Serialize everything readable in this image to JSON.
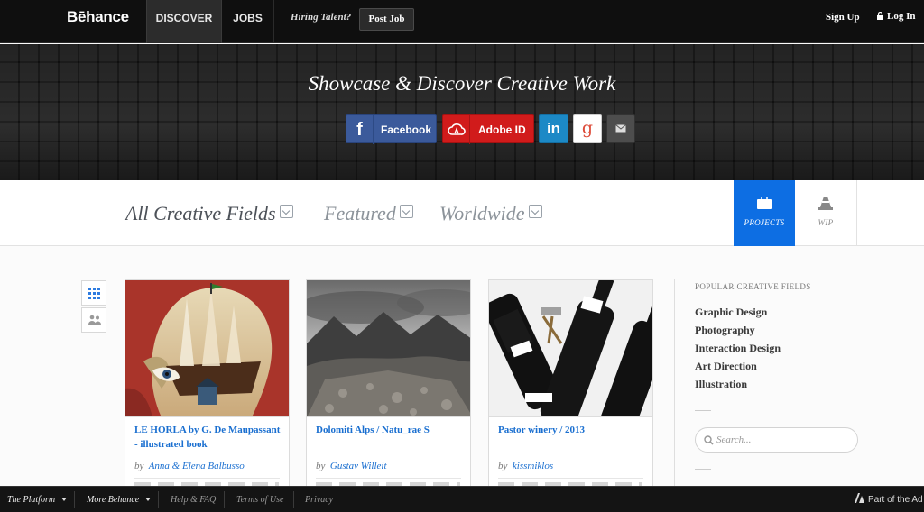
{
  "topbar": {
    "logo": "Bēhance",
    "nav_discover": "DISCOVER",
    "nav_jobs": "JOBS",
    "hiring_text": "Hiring Talent?",
    "post_job": "Post Job",
    "sign_up": "Sign Up",
    "log_in": "Log In"
  },
  "hero": {
    "title": "Showcase & Discover Creative Work",
    "facebook_label": "Facebook",
    "adobe_label": "Adobe ID",
    "linkedin_glyph": "in",
    "google_glyph": "g"
  },
  "filters": {
    "field": "All Creative Fields",
    "sort": "Featured",
    "location": "Worldwide"
  },
  "tabs": {
    "projects": "PROJECTS",
    "wip": "WIP"
  },
  "cards": [
    {
      "title": "LE HORLA by G. De Maupassant - illustrated book",
      "by": "by",
      "author": "Anna & Elena Balbusso"
    },
    {
      "title": "Dolomiti Alps / Natu_rae S",
      "by": "by",
      "author": "Gustav Willeit"
    },
    {
      "title": "Pastor winery / 2013",
      "by": "by",
      "author": "kissmiklos"
    }
  ],
  "sidebar": {
    "heading": "POPULAR CREATIVE FIELDS",
    "fields": [
      "Graphic Design",
      "Photography",
      "Interaction Design",
      "Art Direction",
      "Illustration"
    ],
    "search_placeholder": "Search..."
  },
  "footer": {
    "platform": "The Platform",
    "more": "More Behance",
    "help": "Help & FAQ",
    "terms": "Terms of Use",
    "privacy": "Privacy",
    "adobe": "Part of the Ad"
  },
  "colors": {
    "accent": "#0d6ee3",
    "link": "#1a6fd0",
    "facebook": "#3b5a9b",
    "adobe": "#d11b1b",
    "linkedin": "#1c89c6"
  }
}
